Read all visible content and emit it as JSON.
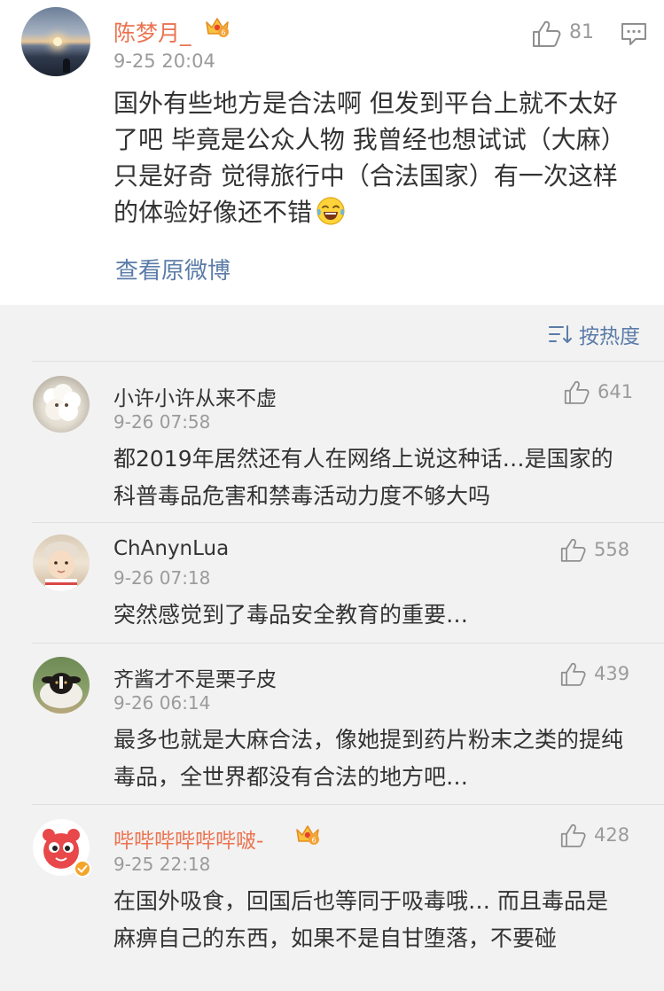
{
  "main_comment": {
    "user_name": "陈梦月_",
    "badge_icon": "vip-crown-badge",
    "time": "9-25 20:04",
    "like_count": "81",
    "text": "国外有些地方是合法啊 但发到平台上就不太好了吧 毕竟是公众人物 我曾经也想试试（大麻）只是好奇 觉得旅行中（合法国家）有一次这样的体验好像还不错",
    "emoji_icon": "laugh-tears-emoji",
    "view_original_label": "查看原微博"
  },
  "sort": {
    "label": "按热度",
    "icon": "sort-icon"
  },
  "replies": [
    {
      "user_name": "小许小许从来不虚",
      "time": "9-26 07:58",
      "like_count": "641",
      "text": "都2019年居然还有人在网络上说这种话…是国家的科普毒品危害和禁毒活动力度不够大吗"
    },
    {
      "user_name": "ChAnynLua",
      "time": "9-26 07:18",
      "like_count": "558",
      "text": "突然感觉到了毒品安全教育的重要…"
    },
    {
      "user_name": "齐酱才不是栗子皮",
      "time": "9-26 06:14",
      "like_count": "439",
      "text": "最多也就是大麻合法，像她提到药片粉末之类的提纯毒品，全世界都没有合法的地方吧…"
    },
    {
      "user_name": "哔哔哔哔哔哔啵-",
      "time": "9-25 22:18",
      "like_count": "428",
      "text": "在国外吸食，回国后也等同于吸毒哦… 而且毒品是麻痹自己的东西，如果不是自甘堕落，不要碰"
    }
  ],
  "colors": {
    "vip_name": "#eb7350",
    "link": "#5b7ca8",
    "meta": "#9b9b9b",
    "text": "#333333",
    "panel_bg": "#f2f2f2"
  }
}
